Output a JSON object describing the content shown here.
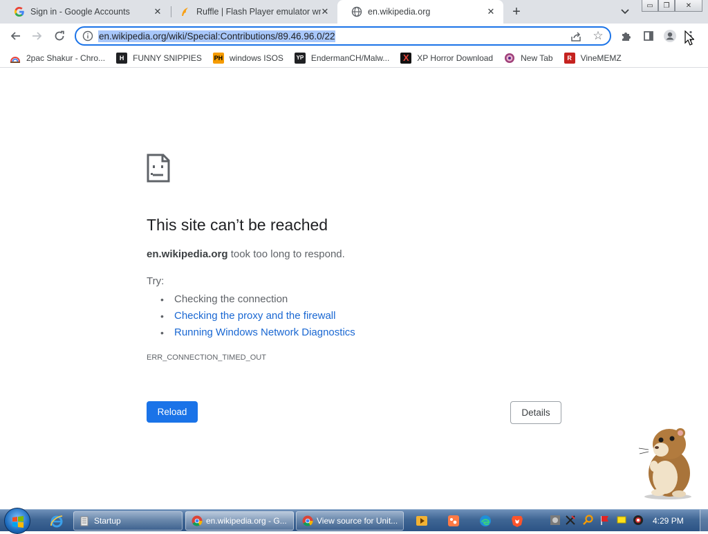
{
  "tabs": [
    {
      "title": "Sign in - Google Accounts",
      "icon": "google-g-icon"
    },
    {
      "title": "Ruffle | Flash Player emulator wri",
      "icon": "ruffle-icon"
    },
    {
      "title": "en.wikipedia.org",
      "icon": "globe-icon",
      "active": true
    }
  ],
  "window_buttons": {
    "minimize": "▭",
    "restore": "❐",
    "close": "✕"
  },
  "omnibox": {
    "url": "en.wikipedia.org/wiki/Special:Contributions/89.46.96.0/22"
  },
  "bookmarks": [
    {
      "label": "2pac Shakur - Chro...",
      "icon": "rainbow-icon",
      "color": "#e8453c"
    },
    {
      "label": "FUNNY SNIPPIES",
      "icon": "h-logo-icon",
      "color": "#202124"
    },
    {
      "label": "windows ISOS",
      "icon": "ph-logo-icon",
      "color": "#f59b00"
    },
    {
      "label": "EndermanCH/Malw...",
      "icon": "yp-logo-icon",
      "color": "#202124"
    },
    {
      "label": "XP Horror Download",
      "icon": "x-logo-icon",
      "color": "#c5221f"
    },
    {
      "label": "New Tab",
      "icon": "spiral-icon",
      "color": "#a0417a"
    },
    {
      "label": "VineMEMZ",
      "icon": "r-logo-icon",
      "color": "#c5221f"
    }
  ],
  "error": {
    "title": "This site can’t be reached",
    "host": "en.wikipedia.org",
    "desc_rest": " took too long to respond.",
    "try_label": "Try:",
    "suggestions": [
      "Checking the connection",
      "Checking the proxy and the firewall",
      "Running Windows Network Diagnostics"
    ],
    "code": "ERR_CONNECTION_TIMED_OUT",
    "reload_label": "Reload",
    "details_label": "Details"
  },
  "taskbar": {
    "buttons": [
      {
        "label": "Startup",
        "icon": "folder-icon"
      },
      {
        "label": "en.wikipedia.org - G...",
        "icon": "chrome-icon"
      },
      {
        "label": "View source for Unit...",
        "icon": "chrome-icon"
      }
    ],
    "clock": "4:29 PM"
  },
  "colors": {
    "accent": "#1a73e8",
    "link": "#1967d2",
    "url_selection": "#a8c7fa"
  }
}
